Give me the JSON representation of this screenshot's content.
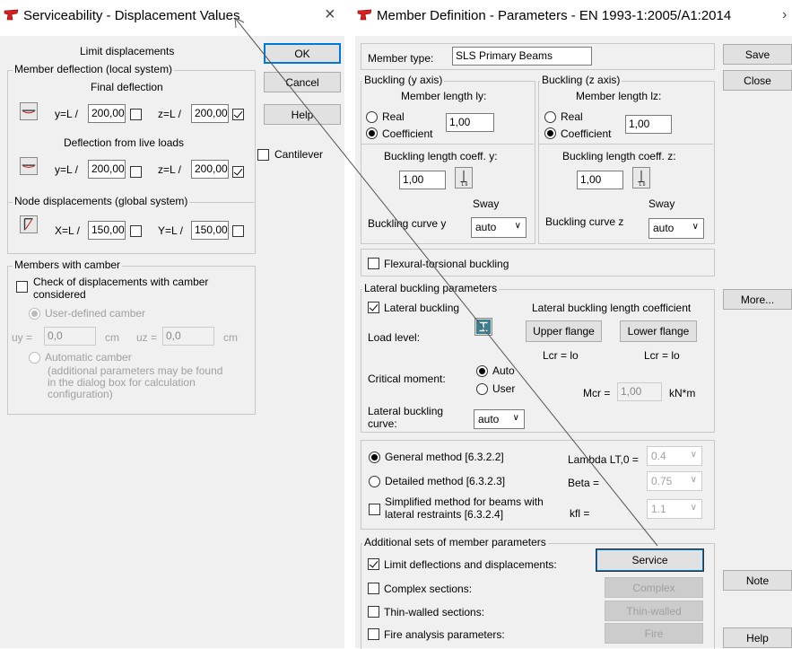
{
  "left": {
    "title": "Serviceability - Displacement Values",
    "limit_heading": "Limit displacements",
    "member_deflection": {
      "label": "Member deflection (local system)",
      "final_heading": "Final deflection",
      "final_y_label": "y=L /",
      "final_y_value": "200,00",
      "final_z_label": "z=L /",
      "final_z_value": "200,00",
      "live_heading": "Deflection from live loads",
      "live_y_label": "y=L /",
      "live_y_value": "200,00",
      "live_z_label": "z=L /",
      "live_z_value": "200,00"
    },
    "node_disp": {
      "label": "Node displacements (global system)",
      "x_label": "X=L /",
      "x_value": "150,00",
      "y_label": "Y=L /",
      "y_value": "150,00"
    },
    "camber": {
      "label": "Members with camber",
      "check_label_1": "Check of displacements with camber",
      "check_label_2": "considered",
      "user_defined": "User-defined camber",
      "uy_label": "uy =",
      "uy_value": "0,0",
      "uy_unit": "cm",
      "uz_label": "uz =",
      "uz_value": "0,0",
      "uz_unit": "cm",
      "automatic": "Automatic camber",
      "note_1": "(additional parameters may be found",
      "note_2": "in the dialog box for calculation",
      "note_3": "configuration)"
    },
    "buttons": {
      "ok": "OK",
      "cancel": "Cancel",
      "help": "Help"
    },
    "cantilever": "Cantilever"
  },
  "right": {
    "title": "Member Definition - Parameters - EN 1993-1:2005/A1:2014",
    "member_type_label": "Member type:",
    "member_type_value": "SLS Primary Beams",
    "buttons": {
      "save": "Save",
      "close": "Close",
      "more": "More...",
      "note": "Note",
      "help": "Help"
    },
    "buck_y": {
      "label": "Buckling (y axis)",
      "member_length": "Member length ly:",
      "real": "Real",
      "coefficient": "Coefficient",
      "value": "1,00",
      "coeff_label": "Buckling length coeff. y:",
      "coeff_value": "1,00",
      "sway": "Sway",
      "curve_label": "Buckling curve y",
      "curve_value": "auto"
    },
    "buck_z": {
      "label": "Buckling (z axis)",
      "member_length": "Member length lz:",
      "real": "Real",
      "coefficient": "Coefficient",
      "value": "1,00",
      "coeff_label": "Buckling length coeff. z:",
      "coeff_value": "1,00",
      "sway": "Sway",
      "curve_label": "Buckling curve z",
      "curve_value": "auto"
    },
    "flexural": "Flexural-torsional buckling",
    "lateral": {
      "label": "Lateral buckling parameters",
      "check": "Lateral buckling",
      "coef_heading": "Lateral buckling length coefficient",
      "load_level": "Load level:",
      "upper": "Upper flange",
      "lower": "Lower flange",
      "lcr1": "Lcr =  lo",
      "lcr2": "Lcr =  lo",
      "critical": "Critical moment:",
      "auto": "Auto",
      "user": "User",
      "mcr_label": "Mcr =",
      "mcr_value": "1,00",
      "mcr_unit": "kN*m",
      "curve_label_1": "Lateral buckling",
      "curve_label_2": "curve:",
      "curve_value": "auto"
    },
    "methods": {
      "general": "General method  [6.3.2.2]",
      "detailed": "Detailed method  [6.3.2.3]",
      "simplified_1": "Simplified method for beams with",
      "simplified_2": "lateral restraints [6.3.2.4]",
      "lambda_label": "Lambda LT,0 =",
      "lambda_value": "0.4",
      "beta_label": "Beta =",
      "beta_value": "0.75",
      "kfl_label": "kfl =",
      "kfl_value": "1.1"
    },
    "additional": {
      "label": "Additional sets of member parameters",
      "limit": "Limit deflections and displacements:",
      "complex": "Complex sections:",
      "thin": "Thin-walled sections:",
      "fire": "Fire analysis parameters:",
      "service_btn": "Service",
      "complex_btn": "Complex",
      "thin_btn": "Thin-walled",
      "fire_btn": "Fire"
    }
  },
  "colors": {
    "accent": "#0078d7",
    "panel": "#f0f0f0",
    "logo_red": "#d82020"
  }
}
